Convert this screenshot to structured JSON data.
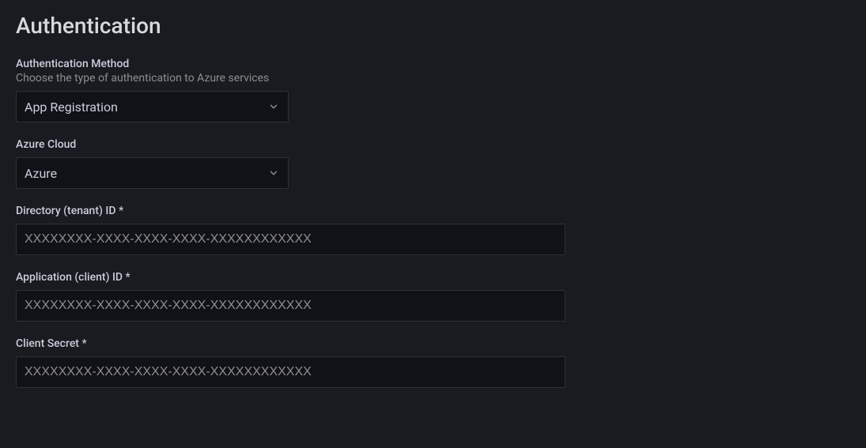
{
  "title": "Authentication",
  "auth_method": {
    "label": "Authentication Method",
    "description": "Choose the type of authentication to Azure services",
    "value": "App Registration"
  },
  "azure_cloud": {
    "label": "Azure Cloud",
    "value": "Azure"
  },
  "tenant_id": {
    "label": "Directory (tenant) ID *",
    "placeholder": "XXXXXXXX-XXXX-XXXX-XXXX-XXXXXXXXXXXX",
    "value": ""
  },
  "client_id": {
    "label": "Application (client) ID *",
    "placeholder": "XXXXXXXX-XXXX-XXXX-XXXX-XXXXXXXXXXXX",
    "value": ""
  },
  "client_secret": {
    "label": "Client Secret *",
    "placeholder": "XXXXXXXX-XXXX-XXXX-XXXX-XXXXXXXXXXXX",
    "value": ""
  }
}
